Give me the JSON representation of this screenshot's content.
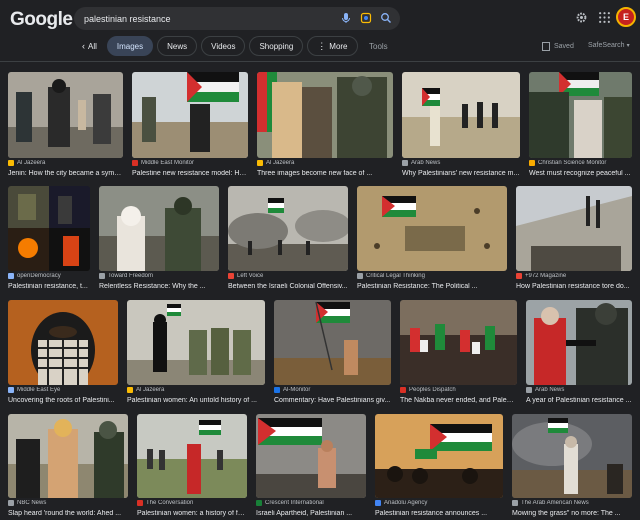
{
  "logo": "Google",
  "search": {
    "query": "palestinian resistance"
  },
  "icons": {
    "mic": "mic-icon",
    "lens": "lens-icon",
    "search": "search-icon",
    "settings": "gear-icon",
    "apps": "apps-grid-icon",
    "back": "chevron-left-icon",
    "more": "more-vert-icon",
    "saved": "bookmark-icon",
    "safe": "caret-down-icon"
  },
  "tabs": [
    {
      "label": "All"
    },
    {
      "label": "Images",
      "active": true
    },
    {
      "label": "News"
    },
    {
      "label": "Videos"
    },
    {
      "label": "Shopping"
    },
    {
      "label": "More"
    }
  ],
  "tools_label": "Tools",
  "saved_label": "Saved",
  "safesearch_label": "SafeSearch",
  "avatar_letter": "E",
  "results": [
    {
      "source": "Al Jazeera",
      "title": "Jenin: How the city became a symb...",
      "fav": "#fbbc04"
    },
    {
      "source": "Middle East Monitor",
      "title": "Palestine new resistance model: Ho...",
      "fav": "#d93025"
    },
    {
      "source": "Al Jazeera",
      "title": "Three images become new face of ...",
      "fav": "#fbbc04"
    },
    {
      "source": "Arab News",
      "title": "Why Palestinians' new resistance m...",
      "fav": "#9aa0a6"
    },
    {
      "source": "Christian Science Monitor",
      "title": "West must recognize peaceful ...",
      "fav": "#f9ab00"
    },
    {
      "source": "openDemocracy",
      "title": "Palestinian resistance, t...",
      "fav": "#8ab4f8"
    },
    {
      "source": "Toward Freedom",
      "title": "Relentless Resistance: Why the ...",
      "fav": "#9aa0a6"
    },
    {
      "source": "Left Voice",
      "title": "Between the Israeli Colonial Offensiv...",
      "fav": "#ea4335"
    },
    {
      "source": "Critical Legal Thinking",
      "title": "Palestinian Resistance: The Political ...",
      "fav": "#9aa0a6"
    },
    {
      "source": "+972 Magazine",
      "title": "How Palestinian resistance tore do...",
      "fav": "#ea4335"
    },
    {
      "source": "Middle East Eye",
      "title": "Uncovering the roots of Palestini...",
      "fav": "#8ab4f8"
    },
    {
      "source": "Al Jazeera",
      "title": "Palestinian women: An untold history of ...",
      "fav": "#fbbc04"
    },
    {
      "source": "Al-Monitor",
      "title": "Commentary: Have Palestinians giv...",
      "fav": "#1a73e8"
    },
    {
      "source": "Peoples Dispatch",
      "title": "The Nakba never ended, and Palesti...",
      "fav": "#d93025"
    },
    {
      "source": "Arab News",
      "title": "A year of Palestinian resistance ...",
      "fav": "#9aa0a6"
    },
    {
      "source": "NBC News",
      "title": "Slap heard 'round the world: Ahed ...",
      "fav": "#9aa0a6"
    },
    {
      "source": "The Conversation",
      "title": "Palestinian women: a history of fe...",
      "fav": "#d93025"
    },
    {
      "source": "Crescent International",
      "title": "Israeli Apartheid, Palestinian ...",
      "fav": "#188038"
    },
    {
      "source": "Anadolu Agency",
      "title": "Palestinian resistance announces ...",
      "fav": "#4285f4"
    },
    {
      "source": "The Arab American News",
      "title": "Mowing the grass\" no more: The ...",
      "fav": "#9aa0a6"
    }
  ]
}
